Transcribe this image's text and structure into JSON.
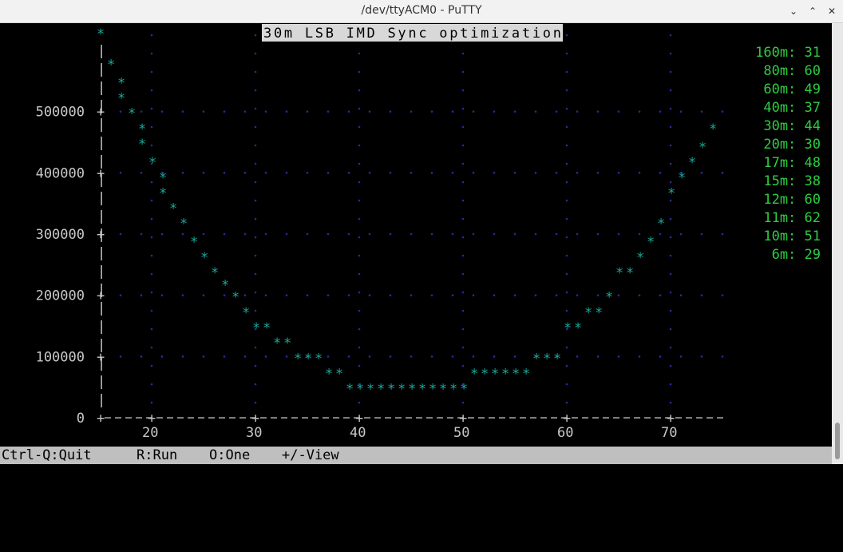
{
  "window": {
    "title": "/dev/ttyACM0 - PuTTY"
  },
  "controls": {
    "minimize": "⌄",
    "maximize": "⌃",
    "close": "✕"
  },
  "colors": {
    "point": "#1aa89a",
    "grid": "#2a2aa0",
    "axis": "#c8c8c8",
    "band": "#2ecc40",
    "title_bg": "#d8d8d8"
  },
  "status": {
    "quit": "Ctrl-Q:Quit",
    "run": "R:Run",
    "one": "O:One",
    "view": "+/-View"
  },
  "bands": [
    {
      "label": "160m: 31"
    },
    {
      "label": "80m: 60"
    },
    {
      "label": "60m: 49"
    },
    {
      "label": "40m: 37"
    },
    {
      "label": "30m: 44"
    },
    {
      "label": "20m: 30"
    },
    {
      "label": "17m: 48"
    },
    {
      "label": "15m: 38"
    },
    {
      "label": "12m: 60"
    },
    {
      "label": "11m: 62"
    },
    {
      "label": "10m: 51"
    },
    {
      "label": "6m: 29"
    }
  ],
  "chart_data": {
    "type": "scatter",
    "title": "30m LSB IMD Sync optimization",
    "marker": "*",
    "xlabel": "",
    "ylabel": "",
    "x_ticks": [
      "20",
      "30",
      "40",
      "50",
      "60",
      "70"
    ],
    "y_ticks": [
      "500000",
      "400000",
      "300000",
      "200000",
      "100000",
      "0"
    ],
    "xlim": [
      15,
      75
    ],
    "ylim": [
      0,
      630000
    ],
    "grid": true,
    "x": [
      15,
      16,
      17,
      17,
      18,
      19,
      19,
      20,
      21,
      21,
      22,
      23,
      24,
      25,
      26,
      27,
      28,
      29,
      30,
      31,
      32,
      33,
      34,
      35,
      36,
      37,
      38,
      39,
      40,
      41,
      42,
      43,
      44,
      45,
      46,
      47,
      48,
      49,
      50,
      51,
      52,
      53,
      54,
      55,
      56,
      57,
      58,
      59,
      60,
      61,
      62,
      63,
      64,
      65,
      66,
      67,
      68,
      69,
      70,
      71,
      72,
      73,
      74
    ],
    "y": [
      630000,
      580000,
      550000,
      525000,
      500000,
      475000,
      450000,
      420000,
      395000,
      370000,
      345000,
      320000,
      290000,
      265000,
      240000,
      220000,
      200000,
      175000,
      150000,
      150000,
      125000,
      125000,
      100000,
      100000,
      100000,
      75000,
      75000,
      50000,
      50000,
      50000,
      50000,
      50000,
      50000,
      50000,
      50000,
      50000,
      50000,
      50000,
      50000,
      75000,
      75000,
      75000,
      75000,
      75000,
      75000,
      100000,
      100000,
      100000,
      150000,
      150000,
      175000,
      175000,
      200000,
      240000,
      240000,
      265000,
      290000,
      320000,
      370000,
      395000,
      420000,
      445000,
      475000
    ]
  }
}
